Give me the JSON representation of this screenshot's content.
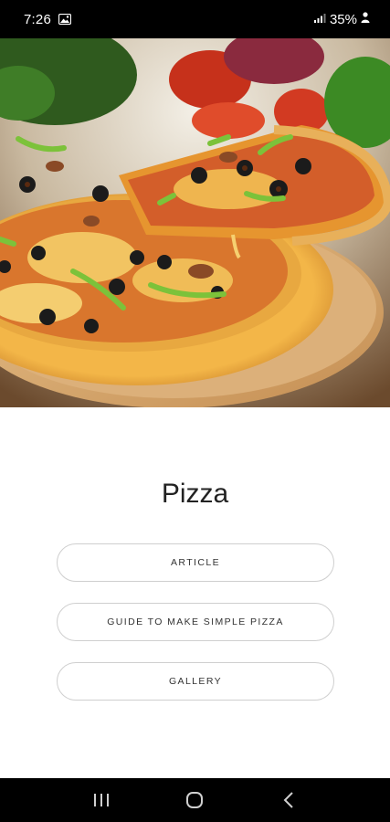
{
  "status_bar": {
    "time": "7:26",
    "battery": "35%"
  },
  "page": {
    "title": "Pizza"
  },
  "menu": {
    "article_label": "ARTICLE",
    "guide_label": "GUIDE TO MAKE SIMPLE PIZZA",
    "gallery_label": "GALLERY"
  },
  "icons": {
    "status_image": "image-icon",
    "signal": "signal-icon",
    "battery": "battery-icon",
    "recent": "recent-apps-icon",
    "home": "home-icon",
    "back": "back-icon"
  }
}
